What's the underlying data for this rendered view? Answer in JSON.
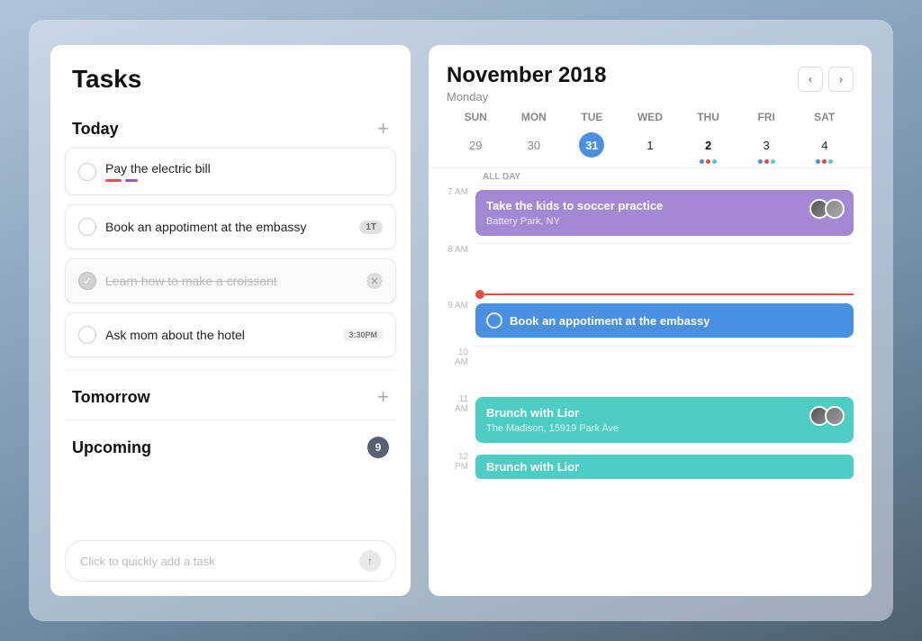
{
  "app": {
    "title": "Tasks"
  },
  "left": {
    "sections": [
      {
        "id": "today",
        "label": "Today",
        "tasks": [
          {
            "id": "t1",
            "text": "Pay the electric bill",
            "completed": false,
            "has_underlines": true
          },
          {
            "id": "t2",
            "text": "Book an appotiment at the embassy",
            "completed": false,
            "badge": "1T"
          },
          {
            "id": "t3",
            "text": "Learn how to make a croissant",
            "completed": true
          },
          {
            "id": "t4",
            "text": "Ask mom about the hotel",
            "completed": false,
            "time_badge": "3:30PM"
          }
        ]
      },
      {
        "id": "tomorrow",
        "label": "Tomorrow"
      },
      {
        "id": "upcoming",
        "label": "Upcoming",
        "count": "9"
      }
    ],
    "quick_add_placeholder": "Click to quickly add a task"
  },
  "right": {
    "month": "November 2018",
    "day_label": "Monday",
    "weekdays": [
      "SUN",
      "MON",
      "TUE",
      "WED",
      "THU",
      "FRI",
      "SAT"
    ],
    "days": [
      {
        "num": "29",
        "current": false,
        "today": false
      },
      {
        "num": "30",
        "current": false,
        "today": false
      },
      {
        "num": "31",
        "current": true,
        "today": true
      },
      {
        "num": "1",
        "current": true,
        "today": false
      },
      {
        "num": "2",
        "current": true,
        "today": false,
        "bold": true,
        "dots": [
          "#4a90e2",
          "#e74c3c",
          "#4ecdc4"
        ]
      },
      {
        "num": "3",
        "current": true,
        "today": false,
        "dots": [
          "#4a90e2",
          "#e74c3c",
          "#4ecdc4"
        ]
      },
      {
        "num": "4",
        "current": true,
        "today": false,
        "dots": [
          "#4a90e2",
          "#e74c3c",
          "#4ecdc4"
        ]
      }
    ],
    "all_day_label": "ALL DAY",
    "time_slots": [
      {
        "label": "7 AM",
        "events": [
          {
            "type": "purple",
            "title": "Take the kids to soccer practice",
            "subtitle": "Battery Park, NY",
            "has_avatars": true
          }
        ]
      },
      {
        "label": "8 AM",
        "events": []
      },
      {
        "label": "9 AM",
        "events": [
          {
            "type": "blue",
            "title": "Book an appotiment at the embassy",
            "has_checkbox": true
          }
        ],
        "now_line": true
      },
      {
        "label": "10 AM",
        "events": []
      },
      {
        "label": "11 AM",
        "events": [
          {
            "type": "teal",
            "title": "Brunch with Lior",
            "subtitle": "The Madison, 15919 Park Ave",
            "has_avatars": true
          }
        ]
      },
      {
        "label": "12 PM",
        "events": [
          {
            "type": "teal",
            "title": "Brunch with Lior",
            "short": true
          }
        ]
      }
    ]
  }
}
